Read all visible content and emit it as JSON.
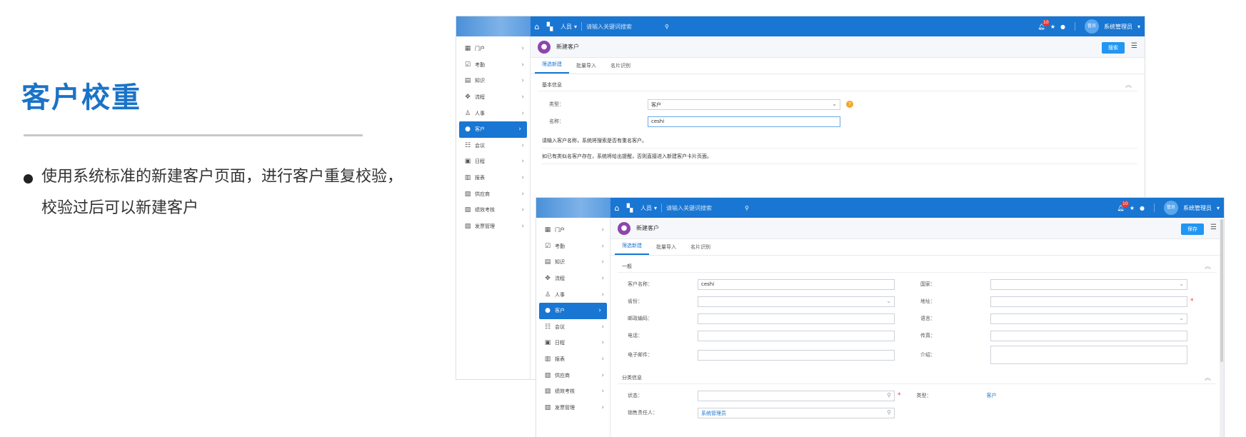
{
  "slide": {
    "title": "客户校重",
    "bullet": "使用系统标准的新建客户页面，进行客户重复校验，校验过后可以新建客户"
  },
  "topbar": {
    "module": "人员",
    "search_placeholder": "请输入关键词搜索",
    "notification_count": "10",
    "avatar_text": "管员",
    "user_name": "系统管理员"
  },
  "sidebar": {
    "items": [
      {
        "label": "门户",
        "icon": "portal-icon",
        "glyph": "▦"
      },
      {
        "label": "考勤",
        "icon": "calendar-check-icon",
        "glyph": "☑"
      },
      {
        "label": "知识",
        "icon": "book-icon",
        "glyph": "▤"
      },
      {
        "label": "流程",
        "icon": "flow-icon",
        "glyph": "✥"
      },
      {
        "label": "人事",
        "icon": "org-icon",
        "glyph": "♙"
      },
      {
        "label": "客户",
        "icon": "user-icon",
        "glyph": "●"
      },
      {
        "label": "会议",
        "icon": "meeting-icon",
        "glyph": "☷"
      },
      {
        "label": "日程",
        "icon": "schedule-icon",
        "glyph": "▣"
      },
      {
        "label": "报表",
        "icon": "chart-icon",
        "glyph": "▥"
      },
      {
        "label": "供应商",
        "icon": "supplier-icon",
        "glyph": "▧"
      },
      {
        "label": "绩效考核",
        "icon": "performance-icon",
        "glyph": "▧"
      },
      {
        "label": "发票管理",
        "icon": "invoice-icon",
        "glyph": "▧"
      }
    ],
    "active_index": 5
  },
  "window1": {
    "page_title": "新建客户",
    "action_button": "搜索",
    "tabs": [
      "筛选新建",
      "批量导入",
      "名片识别"
    ],
    "section": "基本信息",
    "fields": {
      "type_label": "类型：",
      "type_value": "客户",
      "name_label": "名称：",
      "name_value": "ceshi"
    },
    "note1": "请输入客户名称，系统将搜索是否有重名客户。",
    "note2": "如已有类似名客户存在，系统将给出提醒，否则直接进入新建客户卡片页面。"
  },
  "window2": {
    "page_title": "新建客户",
    "action_button": "保存",
    "tabs": [
      "筛选新建",
      "批量导入",
      "名片识别"
    ],
    "section_general": "一般",
    "section_category": "分类信息",
    "general_rows": [
      {
        "l1": "客户名称：",
        "v1": "ceshi",
        "l2": "国家：",
        "v2": "",
        "c2": true
      },
      {
        "l1": "省份：",
        "v1": "",
        "c1": true,
        "l2": "地址：",
        "v2": "",
        "req2": true
      },
      {
        "l1": "邮政编码：",
        "v1": "",
        "l2": "语言：",
        "v2": "",
        "c2": true
      },
      {
        "l1": "电话：",
        "v1": "",
        "l2": "传真：",
        "v2": ""
      },
      {
        "l1": "电子邮件：",
        "v1": "",
        "l2": "介绍：",
        "v2": ""
      }
    ],
    "category_rows": {
      "status_label": "状态：",
      "type_label": "类型：",
      "type_value": "客户",
      "owner_label": "销售责任人：",
      "owner_value": "系统管理员"
    }
  }
}
